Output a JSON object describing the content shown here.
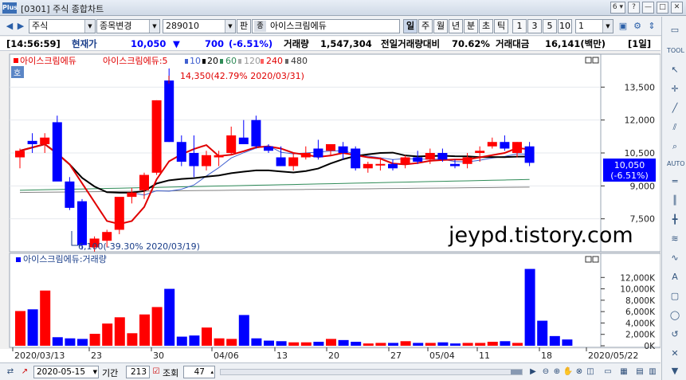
{
  "window": {
    "logo": "Plus",
    "title": "[0301] 주식 종합차트",
    "window_number": "6",
    "controls": [
      "▾",
      "?",
      "—",
      "□",
      "✕"
    ]
  },
  "toolbar": {
    "market_select": "주식",
    "sector_select": "종목변경",
    "code_input": "289010",
    "pan_label": "판",
    "name_tag": "종",
    "stock_name": "아이스크림에듀",
    "periods": [
      "일",
      "주",
      "월",
      "년",
      "분",
      "초",
      "틱"
    ],
    "active_period": "일",
    "intervals": [
      "1",
      "3",
      "5",
      "10"
    ],
    "interval_value": "1"
  },
  "info": {
    "time": "[14:56:59]",
    "current_label": "현재가",
    "current_price": "10,050",
    "direction": "▼",
    "change": "700",
    "change_pct": "(-6.51%)",
    "volume_label": "거래량",
    "volume": "1,547,304",
    "prev_volume_label": "전일거래량대비",
    "prev_volume_ratio": "70.62%",
    "amount_label": "거래대금",
    "amount": "16,141(백만)",
    "unit": "[1일]"
  },
  "price_panel": {
    "legend": [
      "아이스크림에듀",
      "아이스크림에듀:5",
      "10",
      "20",
      "60",
      "120",
      "240",
      "480"
    ],
    "ho_label": "호",
    "high_annotation": "14,350(42.79% 2020/03/31)",
    "low_annotation": "6,100(-39.30% 2020/03/19)",
    "y_ticks": [
      "13,500",
      "12,000",
      "10,500",
      "9,000",
      "7,500"
    ],
    "current_tag": [
      "10,050",
      "(-6.51%)"
    ],
    "watermark": "jeypd.tistory.com"
  },
  "volume_panel": {
    "legend": "아이스크림에듀:거래량",
    "y_ticks": [
      "12,000K",
      "10,000K",
      "8,000K",
      "6,000K",
      "4,000K",
      "2,000K",
      "0K"
    ]
  },
  "x_labels": [
    "2020/03/13",
    "23",
    "30",
    "04/06",
    "13",
    "20",
    "27",
    "05/04",
    "11",
    "18",
    "2020/05/22"
  ],
  "bottom": {
    "date": "2020-05-15",
    "period_label": "기간",
    "period_value": "213",
    "lookup_label": "조회",
    "lookup_value": "47"
  },
  "colors": {
    "up": "#ff0000",
    "down": "#0000ff",
    "ma5": "#e00000",
    "ma20": "#000000",
    "ma60": "#2e8b57",
    "ma120": "#808080",
    "ma10": "#4060d0"
  },
  "chart_data": {
    "type": "candlestick",
    "dates": [
      "03/13",
      "03/16",
      "03/17",
      "03/18",
      "03/19",
      "03/20",
      "03/23",
      "03/24",
      "03/25",
      "03/26",
      "03/27",
      "03/30",
      "03/31",
      "04/01",
      "04/02",
      "04/03",
      "04/06",
      "04/07",
      "04/08",
      "04/09",
      "04/10",
      "04/13",
      "04/14",
      "04/16",
      "04/17",
      "04/20",
      "04/21",
      "04/22",
      "04/23",
      "04/24",
      "04/27",
      "04/28",
      "04/29",
      "05/04",
      "05/06",
      "05/07",
      "05/08",
      "05/11",
      "05/12",
      "05/13",
      "05/14",
      "05/15"
    ],
    "ohlc": [
      [
        10300,
        10700,
        9800,
        10600
      ],
      [
        11050,
        11400,
        10500,
        10900
      ],
      [
        10900,
        11400,
        10500,
        11200
      ],
      [
        11900,
        12200,
        9300,
        9200
      ],
      [
        9200,
        9400,
        7900,
        8000
      ],
      [
        8300,
        8400,
        6100,
        6300
      ],
      [
        6200,
        6700,
        6000,
        6600
      ],
      [
        6500,
        7000,
        6200,
        6900
      ],
      [
        7000,
        8400,
        6800,
        8500
      ],
      [
        8500,
        8900,
        8200,
        8700
      ],
      [
        8800,
        9600,
        8400,
        9500
      ],
      [
        9600,
        12900,
        9500,
        12900
      ],
      [
        13800,
        14350,
        11000,
        11000
      ],
      [
        11000,
        11300,
        9900,
        10100
      ],
      [
        10500,
        11300,
        9400,
        9900
      ],
      [
        9900,
        10600,
        9700,
        10400
      ],
      [
        10300,
        10600,
        9900,
        10400
      ],
      [
        10500,
        11700,
        10400,
        11300
      ],
      [
        11200,
        12000,
        10900,
        10900
      ],
      [
        12000,
        12200,
        10700,
        10800
      ],
      [
        10800,
        10900,
        10500,
        10600
      ],
      [
        10300,
        10800,
        9900,
        9900
      ],
      [
        9900,
        10500,
        9700,
        10300
      ],
      [
        10300,
        10800,
        10200,
        10500
      ],
      [
        10700,
        11100,
        10200,
        10300
      ],
      [
        10600,
        10900,
        10400,
        10900
      ],
      [
        10800,
        11000,
        10200,
        10500
      ],
      [
        10700,
        10800,
        9700,
        9800
      ],
      [
        9800,
        10100,
        9600,
        10000
      ],
      [
        10000,
        10300,
        9700,
        10000
      ],
      [
        10000,
        10200,
        9700,
        9800
      ],
      [
        10000,
        10400,
        9800,
        10300
      ],
      [
        10300,
        10600,
        10000,
        10100
      ],
      [
        10200,
        10700,
        10000,
        10500
      ],
      [
        10500,
        10700,
        10100,
        10200
      ],
      [
        10000,
        10200,
        9800,
        9900
      ],
      [
        10000,
        10500,
        9800,
        10300
      ],
      [
        10500,
        10800,
        10100,
        10600
      ],
      [
        10800,
        11200,
        10700,
        11000
      ],
      [
        11000,
        11300,
        10600,
        10700
      ],
      [
        10500,
        11000,
        10300,
        11000
      ],
      [
        10800,
        11000,
        9900,
        10050
      ]
    ],
    "volume_k": [
      6100,
      6400,
      9700,
      1500,
      1300,
      1200,
      2100,
      3900,
      5000,
      2200,
      5500,
      6800,
      10000,
      1600,
      1800,
      3200,
      1300,
      1200,
      5400,
      1300,
      900,
      800,
      600,
      600,
      700,
      1200,
      1000,
      700,
      400,
      500,
      500,
      800,
      500,
      500,
      600,
      400,
      500,
      500,
      700,
      800,
      500,
      13500,
      4400,
      1700,
      1100
    ],
    "ylim": [
      6000,
      15000
    ],
    "vol_ylim": [
      0,
      14000
    ]
  }
}
